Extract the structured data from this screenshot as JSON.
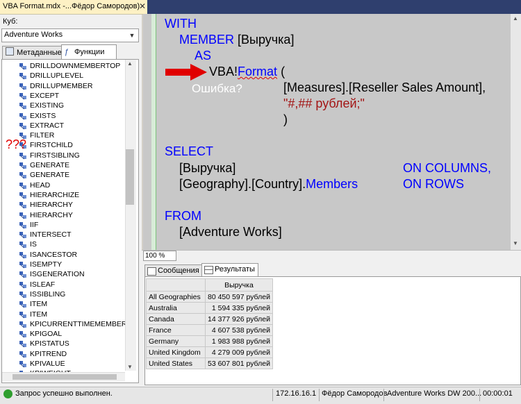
{
  "window": {
    "tab_title": "VBA Format.mdx -...Фёдор Самородов)",
    "close_glyph": "✕"
  },
  "left_pane": {
    "cube_label": "Куб:",
    "cube_value": "Adventure Works",
    "tabs": [
      {
        "label": "Метаданные"
      },
      {
        "label": "Функции"
      }
    ],
    "functions": [
      "DRILLDOWNMEMBERTOP",
      "DRILLUPLEVEL",
      "DRILLUPMEMBER",
      "EXCEPT",
      "EXISTING",
      "EXISTS",
      "EXTRACT",
      "FILTER",
      "FIRSTCHILD",
      "FIRSTSIBLING",
      "GENERATE",
      "GENERATE",
      "HEAD",
      "HIERARCHIZE",
      "HIERARCHY",
      "HIERARCHY",
      "IIF",
      "INTERSECT",
      "IS",
      "ISANCESTOR",
      "ISEMPTY",
      "ISGENERATION",
      "ISLEAF",
      "ISSIBLING",
      "ITEM",
      "ITEM",
      "KPICURRENTTIMEMEMBER",
      "KPIGOAL",
      "KPISTATUS",
      "KPITREND",
      "KPIVALUE",
      "KPIWEIGHT"
    ],
    "annotation": "???"
  },
  "editor": {
    "lines": {
      "with": "WITH",
      "member_kw": "MEMBER",
      "member_name": "[Выручка]",
      "as": "AS",
      "vba": "VBA!",
      "format": "Format",
      "paren_open": "(",
      "measure": "[Measures].[Reseller Sales Amount],",
      "format_string": "\"#,## рублей;\"",
      "paren_close": ")",
      "select": "SELECT",
      "select_item1": "[Выручка]",
      "on_columns": "ON COLUMNS,",
      "select_item2": "[Geography].[Country].",
      "members": "Members",
      "on_rows": "ON ROWS",
      "from": "FROM",
      "cube": "[Adventure Works]"
    },
    "annotation": "Ошибка?",
    "zoom": "100 %"
  },
  "results": {
    "tabs": [
      {
        "label": "Сообщения"
      },
      {
        "label": "Результаты"
      }
    ],
    "column_header": "Выручка",
    "rows": [
      {
        "label": "All Geographies",
        "value": "80 450 597 рублей"
      },
      {
        "label": "Australia",
        "value": "1 594 335 рублей"
      },
      {
        "label": "Canada",
        "value": "14 377 926 рублей"
      },
      {
        "label": "France",
        "value": "4 607 538 рублей"
      },
      {
        "label": "Germany",
        "value": "1 983 988 рублей"
      },
      {
        "label": "United Kingdom",
        "value": "4 279 009 рублей"
      },
      {
        "label": "United States",
        "value": "53 607 801 рублей"
      }
    ]
  },
  "status_bar": {
    "message": "Запрос успешно выполнен.",
    "server": "172.16.16.1",
    "user": "Фёдор Самородов",
    "database": "Adventure Works DW 200...",
    "elapsed": "00:00:01"
  },
  "colors": {
    "keyword": "#0000ff",
    "string": "#a31515",
    "arrow": "#e00000",
    "ok": "#2e9e2e"
  }
}
